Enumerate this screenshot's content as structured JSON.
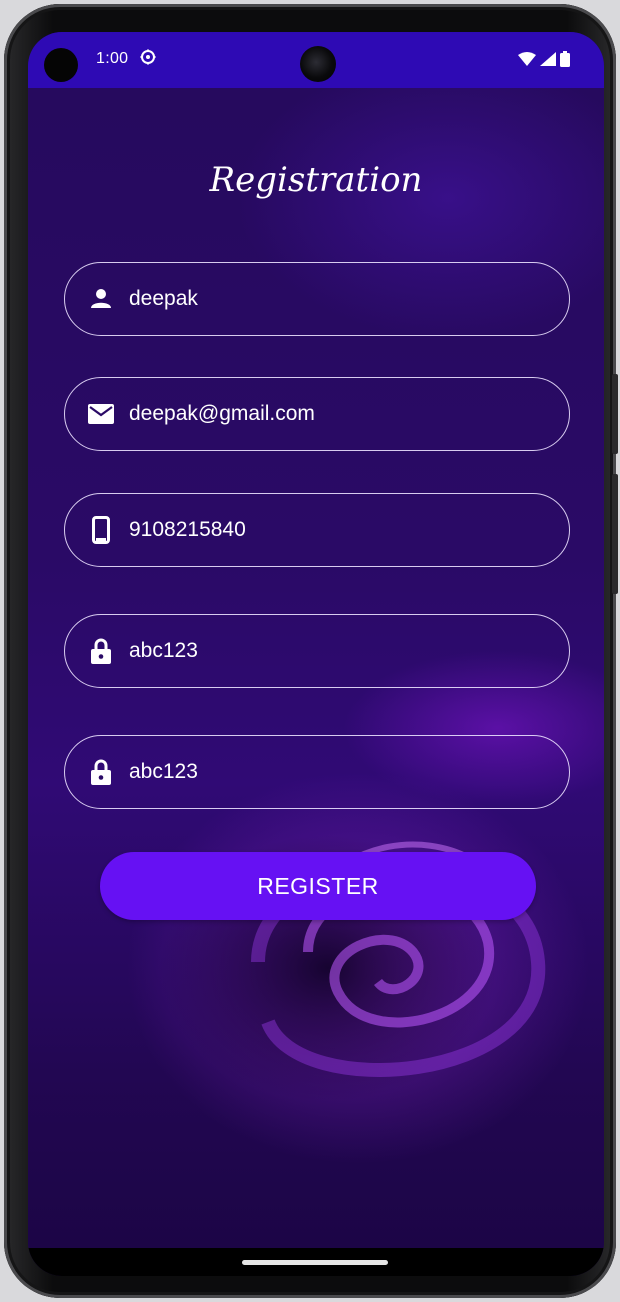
{
  "status_bar": {
    "time": "1:00",
    "icons": [
      "settings-gear-icon",
      "wifi-icon",
      "cellular-signal-icon",
      "battery-icon"
    ],
    "background": "#2e0ab4"
  },
  "screen": {
    "title": "Registration",
    "fields": [
      {
        "name": "name-field",
        "icon": "person-icon",
        "value": "deepak"
      },
      {
        "name": "email-field",
        "icon": "envelope-icon",
        "value": "deepak@gmail.com"
      },
      {
        "name": "phone-field",
        "icon": "smartphone-icon",
        "value": "9108215840"
      },
      {
        "name": "password-field",
        "icon": "lock-icon",
        "value": "abc123"
      },
      {
        "name": "confirm-password-field",
        "icon": "lock-icon",
        "value": "abc123"
      }
    ],
    "register_label": "REGISTER"
  },
  "colors": {
    "accent": "#6611f3",
    "background": "#2a0a66",
    "field_border": "#ebe1ff",
    "text": "#ffffff"
  }
}
